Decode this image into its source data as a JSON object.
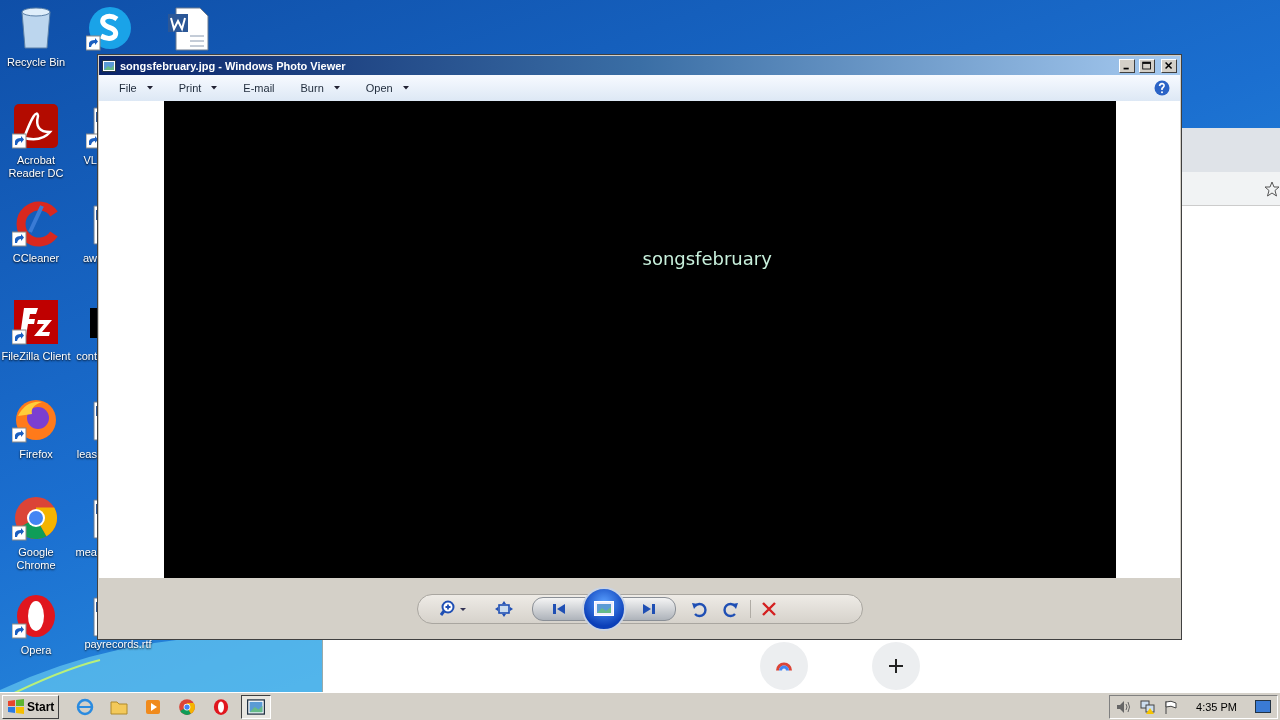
{
  "desktop": {
    "icon_columns": [
      [
        {
          "label": "Recycle Bin",
          "kind": "recycle-bin",
          "shortcut": false
        },
        {
          "label": "Acrobat Reader DC",
          "kind": "acrobat",
          "shortcut": true
        },
        {
          "label": "CCleaner",
          "kind": "ccleaner",
          "shortcut": true
        },
        {
          "label": "FileZilla Client",
          "kind": "filezilla",
          "shortcut": true
        },
        {
          "label": "Firefox",
          "kind": "firefox",
          "shortcut": true
        },
        {
          "label": "Google Chrome",
          "kind": "chrome",
          "shortcut": true
        },
        {
          "label": "Opera",
          "kind": "opera",
          "shortcut": true
        }
      ],
      [
        {
          "kind": "skype",
          "shortcut": true
        },
        {
          "label": "VL",
          "kind": "document",
          "shortcut": true
        },
        {
          "label": "aw",
          "kind": "document",
          "shortcut": false
        },
        {
          "label": "cont",
          "kind": "black",
          "shortcut": false
        },
        {
          "label": "leas",
          "kind": "document",
          "shortcut": false
        },
        {
          "label": "mea",
          "kind": "document",
          "shortcut": false
        },
        {
          "label": "payrecords.rtf",
          "kind": "document",
          "shortcut": false
        }
      ],
      [
        {
          "kind": "word",
          "shortcut": false
        }
      ]
    ]
  },
  "photo_viewer": {
    "title": "songsfebruary.jpg - Windows Photo Viewer",
    "menu": [
      {
        "label": "File",
        "dropdown": true
      },
      {
        "label": "Print",
        "dropdown": true
      },
      {
        "label": "E-mail",
        "dropdown": false
      },
      {
        "label": "Burn",
        "dropdown": true
      },
      {
        "label": "Open",
        "dropdown": true
      }
    ],
    "image": {
      "caption": "songsfebruary"
    }
  },
  "taskbar": {
    "start": "Start",
    "clock": "4:35 PM"
  }
}
